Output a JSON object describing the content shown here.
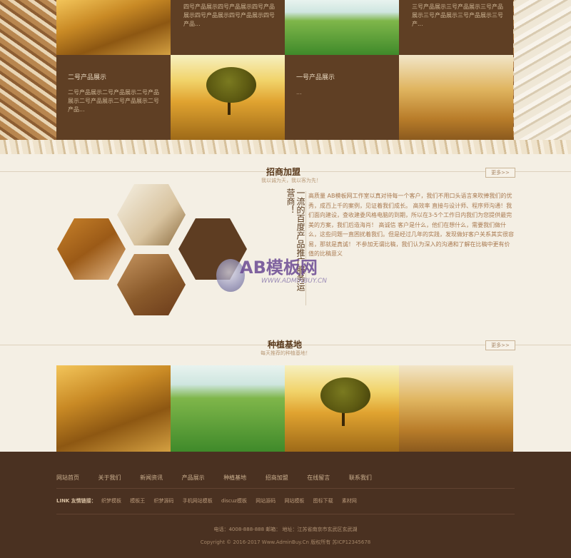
{
  "products": {
    "p4_desc": "四号产品展示四号产品展示四号产品展示四号产品展示四号产品展示四号产品...",
    "p3_desc": "三号产品展示三号产品展示三号产品展示三号产品展示三号产品展示三号产...",
    "p2_title": "二号产品展示",
    "p2_desc": "二号产品展示二号产品展示二号产品展示二号产品展示二号产品展示二号产品...",
    "p1_title": "一号产品展示",
    "p1_desc": "..."
  },
  "franchise": {
    "title": "招商加盟",
    "subtitle": "我以诚为天，我以客为先！",
    "more": "更多>>",
    "slogan": "一流的百度产品推广服务运营商！",
    "intro": "高质量 AB模板网工作室以真对待每一个客户，我们不用口头语言来吹捧我们的优秀，成百上千的案例，见证着我们成长。 高效率 直接与设计师、程序师沟通！我们面向建设，查收建委风格电脑的到期，所以在3-5个工作日内我们为您提供最完美的方案，我们后造海肖！ 高诚信 客户是什么，他们在想什么，需要我们做什么，这些问题一直困扰着我们。但是经过几年的实践，发现做好客户关系其实很容易，那就是真诚！ 不参加无谓比稿，我们认为深入的沟通和了解在比稿中更有价值的比稿意义"
  },
  "watermark": {
    "brand": "AB模板网",
    "url": "WWW.ADMINBUY.CN"
  },
  "base": {
    "title": "种植基地",
    "subtitle": "每天推荐的种植基地！",
    "more": "更多>>"
  },
  "footer": {
    "nav": [
      "网站首页",
      "关于我们",
      "新闻资讯",
      "产品展示",
      "种植基地",
      "招商加盟",
      "在线留言",
      "联系我们"
    ],
    "links_label": "LINK 友情链接：",
    "links": [
      "织梦模板",
      "模板王",
      "织梦源码",
      "手机网站模板",
      "discuz模板",
      "网站源码",
      "网站模板",
      "图标下载",
      "素材网"
    ],
    "contact": "电话：4008-888-888    邮箱：    地址：江苏省南京市玄武区玄武湖",
    "copyright": "Copyright © 2016-2017 Www.AdminBuy.Cn 版权所有   苏ICP12345678"
  }
}
